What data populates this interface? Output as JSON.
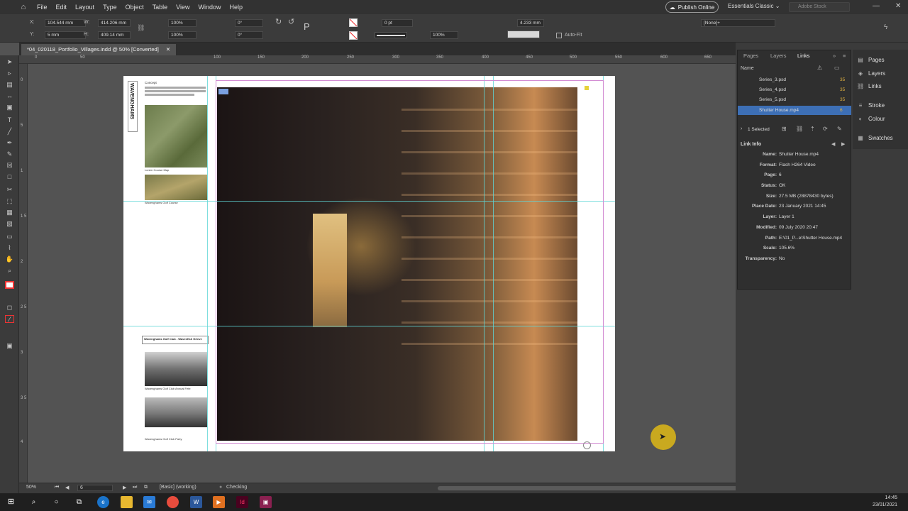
{
  "menubar": {
    "items": [
      "File",
      "Edit",
      "Layout",
      "Type",
      "Object",
      "Table",
      "View",
      "Window",
      "Help"
    ],
    "publish_label": "Publish Online",
    "workspace": "Essentials Classic",
    "search_placeholder": "Adobe Stock"
  },
  "control": {
    "x_label": "X:",
    "x_value": "104.544 mm",
    "y_label": "Y:",
    "y_value": "5 mm",
    "w_label": "W:",
    "w_value": "414.206 mm",
    "h_label": "H:",
    "h_value": "409.14 mm",
    "scale_x": "100%",
    "scale_y": "100%",
    "rotate": "0°",
    "shear": "0°",
    "stroke_weight": "0 pt",
    "opacity": "100%",
    "fit_value": "4.233 mm",
    "autofit_label": "Auto-Fit",
    "style_value": "[None]+"
  },
  "document": {
    "tab_title": "*04_020118_Portfolio_Villages.indd @ 50% [Converted]"
  },
  "rulers": {
    "h_ticks": [
      "0",
      "50",
      "100",
      "150",
      "200",
      "250",
      "300",
      "350",
      "400",
      "450",
      "500",
      "550",
      "600",
      "650"
    ],
    "v_ticks": [
      "0",
      "5",
      "1",
      "1 5",
      "2",
      "2 5",
      "3",
      "3 5",
      "4"
    ]
  },
  "page_content": {
    "vertical_title": "WAVENGHAMS",
    "concept_label": "Concept",
    "map_caption": "Lorem Course Map",
    "course_caption": "Wavenghams Golf Course",
    "club_caption": "Wavenghams Golf Club - Wavenfish Grieve",
    "photo2_caption": "Wavenghams Golf Club Annual Fete",
    "footer_caption": "Wavenghams Golf Club Party"
  },
  "statusbar": {
    "zoom": "50%",
    "page": "6",
    "preflight_profile": "[Basic] (working)",
    "preflight_status": "Checking"
  },
  "panels": {
    "tabs": [
      "Pages",
      "Layers",
      "Links"
    ],
    "column_header": "Name",
    "links": [
      {
        "name": "Series_3.psd",
        "page": "35"
      },
      {
        "name": "Series_4.psd",
        "page": "35"
      },
      {
        "name": "Series_5.psd",
        "page": "35"
      },
      {
        "name": "Shutter House.mp4",
        "page": "6"
      }
    ],
    "selected_count": "1 Selected",
    "link_info_title": "Link Info",
    "link_info": [
      {
        "key": "Name:",
        "value": "Shutter House.mp4"
      },
      {
        "key": "Format:",
        "value": "Flash H264 Video"
      },
      {
        "key": "Page:",
        "value": "6"
      },
      {
        "key": "Status:",
        "value": "OK"
      },
      {
        "key": "Size:",
        "value": "27.5 MB (28878430 bytes)"
      },
      {
        "key": "Place Date:",
        "value": "23 January 2021 14:45"
      },
      {
        "key": "Layer:",
        "value": "Layer 1"
      },
      {
        "key": "Modified:",
        "value": "09 July 2020 20:47"
      },
      {
        "key": "Path:",
        "value": "E:\\01_P...e\\Shutter House.mp4"
      },
      {
        "key": "Scale:",
        "value": "105.6%"
      },
      {
        "key": "Transparency:",
        "value": "No"
      }
    ]
  },
  "dock": {
    "items": [
      "Pages",
      "Layers",
      "Links",
      "Stroke",
      "Colour",
      "Swatches"
    ]
  },
  "taskbar": {
    "time": "14:45",
    "date": "23/01/2021"
  },
  "colors": {
    "guide": "#5fd6d6",
    "selection": "#3d6fb5",
    "cursor_highlight": "#d6b21a"
  }
}
